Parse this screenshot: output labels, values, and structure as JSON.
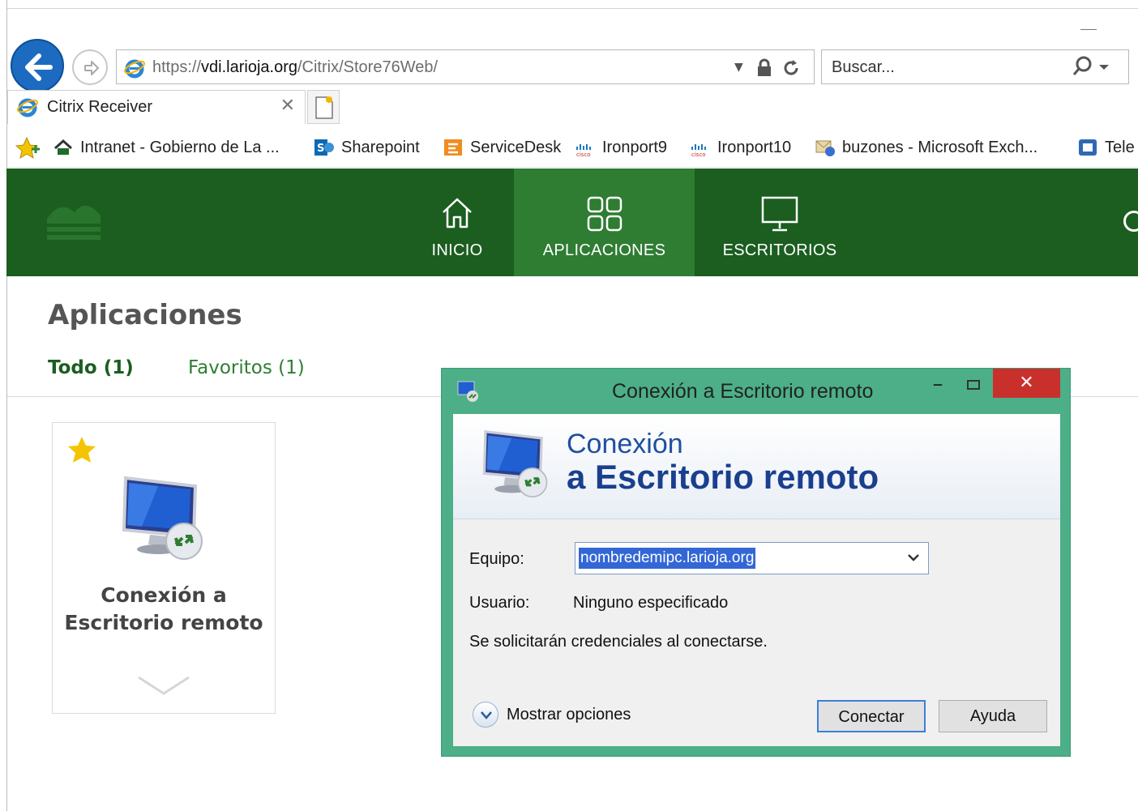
{
  "browser": {
    "url_scheme": "https://",
    "url_host": "vdi.larioja.org",
    "url_path": "/Citrix/Store76Web/",
    "search_placeholder": "Buscar...",
    "tab_title": "Citrix Receiver",
    "favorites": [
      {
        "label": "Intranet - Gobierno de La ...",
        "icon": "intranet-icon"
      },
      {
        "label": "Sharepoint",
        "icon": "sharepoint-icon"
      },
      {
        "label": "ServiceDesk",
        "icon": "servicedesk-icon"
      },
      {
        "label": "Ironport9",
        "icon": "cisco-icon"
      },
      {
        "label": "Ironport10",
        "icon": "cisco-icon"
      },
      {
        "label": "buzones - Microsoft Exch...",
        "icon": "exchange-icon"
      },
      {
        "label": "Tele",
        "icon": "tele-icon"
      }
    ]
  },
  "citrix": {
    "nav": {
      "home": "INICIO",
      "apps": "APLICACIONES",
      "desktops": "ESCRITORIOS"
    },
    "page_title": "Aplicaciones",
    "subtabs": {
      "all": "Todo (1)",
      "favorites": "Favoritos (1)"
    },
    "app_card": {
      "title_line1": "Conexión a",
      "title_line2": "Escritorio remoto"
    }
  },
  "rdp_dialog": {
    "window_title": "Conexión a Escritorio remoto",
    "close_glyph": "✕",
    "heading_line1": "Conexión",
    "heading_line2": "a Escritorio remoto",
    "computer_label": "Equipo:",
    "computer_value": "nombredemipc.larioja.org",
    "user_label": "Usuario:",
    "user_value": "Ninguno especificado",
    "credentials_note": "Se solicitarán credenciales al conectarse.",
    "show_options": "Mostrar opciones",
    "connect_button": "Conectar",
    "help_button": "Ayuda"
  },
  "colors": {
    "header_green": "#1b5e20",
    "active_nav_green": "#2e7d32",
    "dialog_frame": "#4caf88",
    "close_red": "#c9302c",
    "ie_blue": "#1c6bc1"
  }
}
